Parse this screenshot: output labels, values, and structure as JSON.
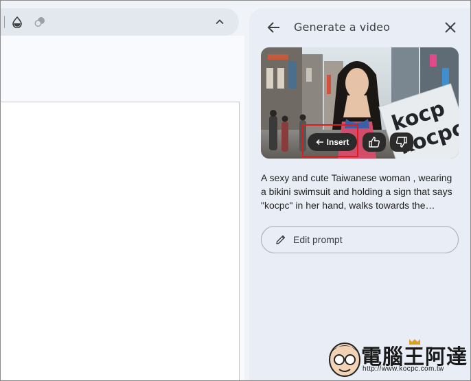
{
  "panel": {
    "title": "Generate a video",
    "insert_label": "Insert",
    "prompt": "A sexy and cute Taiwanese woman , wearing a bikini swimsuit and holding a sign that says \"kocpc\" in her hand, walks towards the…",
    "edit_label": "Edit prompt",
    "sign_text": [
      "kocp",
      "kocpc"
    ]
  },
  "watermark": {
    "name": "電腦王阿達",
    "url": "http://www.kocpc.com.tw"
  },
  "colors": {
    "panel_bg": "#e9eef6",
    "highlight": "#e01b1b",
    "button_dark": "#2b2b2b"
  },
  "icons": {
    "toolbar": [
      "ink-drop-icon",
      "paint-blobs-icon",
      "chevron-up-icon"
    ],
    "panel": [
      "back-arrow-icon",
      "close-icon",
      "arrow-left-icon",
      "thumbs-up-icon",
      "thumbs-down-icon",
      "pencil-icon"
    ]
  }
}
